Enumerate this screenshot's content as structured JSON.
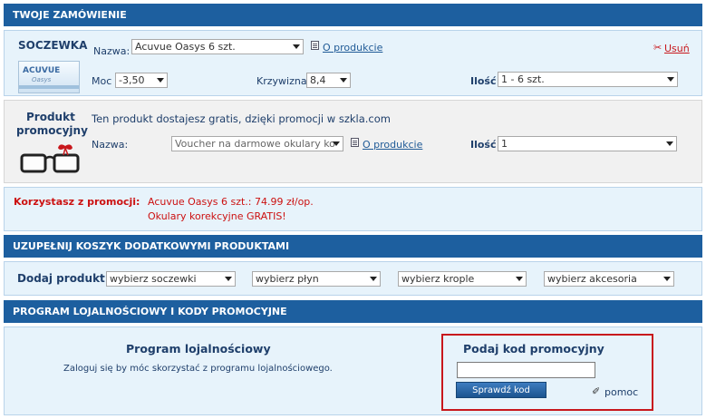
{
  "order": {
    "header": "TWOJE ZAMÓWIENIE",
    "lens": {
      "title": "SOCZEWKA",
      "box_brand": "ACUVUE",
      "box_sub": "Oasys",
      "name_label": "Nazwa:",
      "name_value": "Acuvue Oasys 6 szt.",
      "about_link": "O produkcie",
      "remove_link": "Usuń",
      "power_label": "Moc",
      "power_value": "-3,50",
      "curve_label": "Krzywizna",
      "curve_value": "8,4",
      "qty_label": "Ilość",
      "qty_value": "1 - 6 szt."
    },
    "promo_product": {
      "title_line1": "Produkt",
      "title_line2": "promocyjny",
      "info": "Ten produkt dostajesz gratis, dzięki promocji w szkla.com",
      "name_label": "Nazwa:",
      "name_value": "Voucher na darmowe okulary ko",
      "about_link": "O produkcie",
      "qty_label": "Ilość",
      "qty_value": "1"
    },
    "promotion": {
      "label": "Korzystasz z promocji:",
      "line1": "Acuvue Oasys 6 szt.: 74.99 zł/op.",
      "line2": "Okulary korekcyjne GRATIS!"
    }
  },
  "extras": {
    "header": "UZUPEŁNIJ KOSZYK DODATKOWYMI PRODUKTAMI",
    "label": "Dodaj produkt",
    "selects": [
      "wybierz soczewki",
      "wybierz płyn",
      "wybierz krople",
      "wybierz akcesoria"
    ]
  },
  "loyalty": {
    "header": "PROGRAM LOJALNOŚCIOWY I KODY PROMOCYJNE",
    "title": "Program lojalnościowy",
    "text": "Zaloguj się by móc skorzystać z programu lojalnościowego.",
    "code_title": "Podaj kod promocyjny",
    "code_value": "",
    "check_button": "Sprawdź kod",
    "help_link": "pomoc"
  },
  "colors": {
    "header_bg": "#1d5f9f",
    "panel_bg": "#e7f3fb",
    "promo_red": "#cc1111",
    "highlight_box": "#c8171c"
  }
}
